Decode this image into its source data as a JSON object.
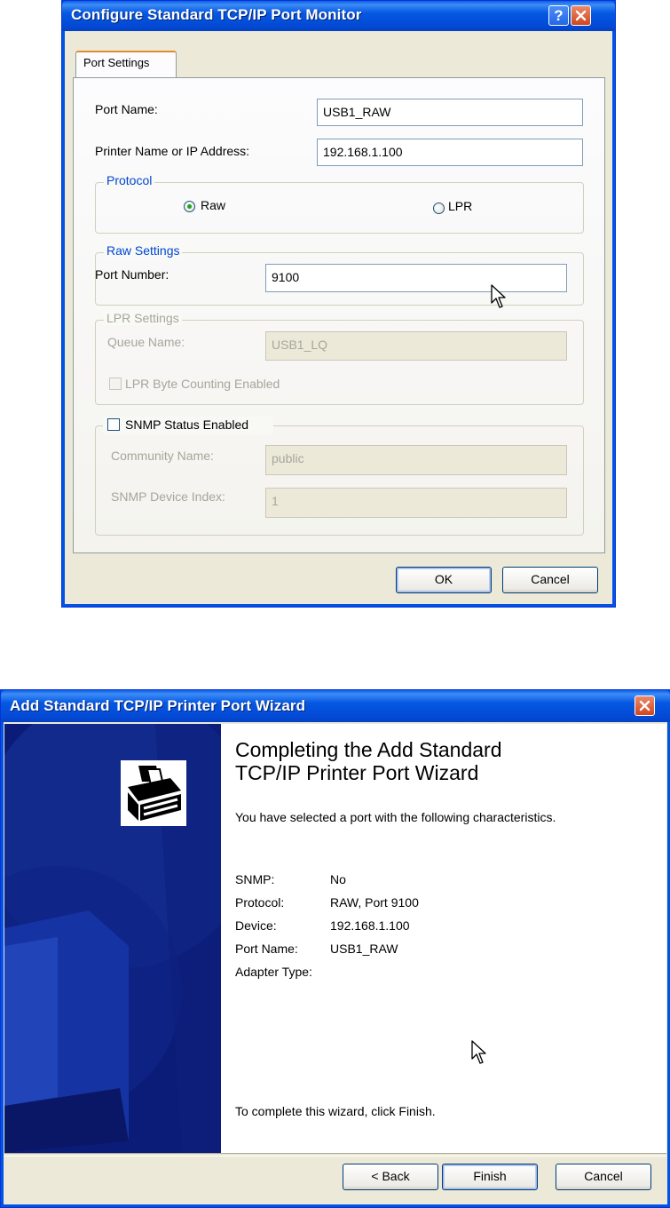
{
  "dialog1": {
    "title": "Configure Standard TCP/IP Port Monitor",
    "tab": "Port Settings",
    "port_name_label": "Port Name:",
    "port_name_value": "USB1_RAW",
    "printer_label": "Printer Name or IP Address:",
    "printer_value": "192.168.1.100",
    "protocol": {
      "group_label": "Protocol",
      "raw_label": "Raw",
      "lpr_label": "LPR",
      "selected": "Raw"
    },
    "raw_settings": {
      "group_label": "Raw Settings",
      "port_number_label": "Port Number:",
      "port_number_value": "9100"
    },
    "lpr_settings": {
      "group_label": "LPR Settings",
      "queue_name_label": "Queue Name:",
      "queue_name_value": "USB1_LQ",
      "byte_counting_label": "LPR Byte Counting Enabled"
    },
    "snmp": {
      "enabled_label": "SNMP Status Enabled",
      "community_label": "Community Name:",
      "community_value": "public",
      "device_index_label": "SNMP Device Index:",
      "device_index_value": "1"
    },
    "ok_label": "OK",
    "cancel_label": "Cancel"
  },
  "dialog2": {
    "title": "Add Standard TCP/IP Printer Port Wizard",
    "heading_line1": "Completing the Add Standard",
    "heading_line2": "TCP/IP Printer Port Wizard",
    "intro": "You have selected a port with the following characteristics.",
    "details": [
      {
        "label": "SNMP:",
        "value": "No"
      },
      {
        "label": "Protocol:",
        "value": "RAW, Port 9100"
      },
      {
        "label": "Device:",
        "value": "192.168.1.100"
      },
      {
        "label": "Port Name:",
        "value": "USB1_RAW"
      },
      {
        "label": "Adapter Type:",
        "value": ""
      }
    ],
    "finish_hint": "To complete this wizard, click Finish.",
    "back_label": "< Back",
    "finish_label": "Finish",
    "cancel_label": "Cancel"
  },
  "colors": {
    "titlebar_blue": "#0558e3",
    "group_title_blue": "#0046d5",
    "wizard_panel_navy": "#0a1e7a",
    "dialog_face": "#ece9d8"
  },
  "icons": [
    "help-icon",
    "close-icon",
    "printer-icon",
    "mouse-cursor-icon"
  ]
}
